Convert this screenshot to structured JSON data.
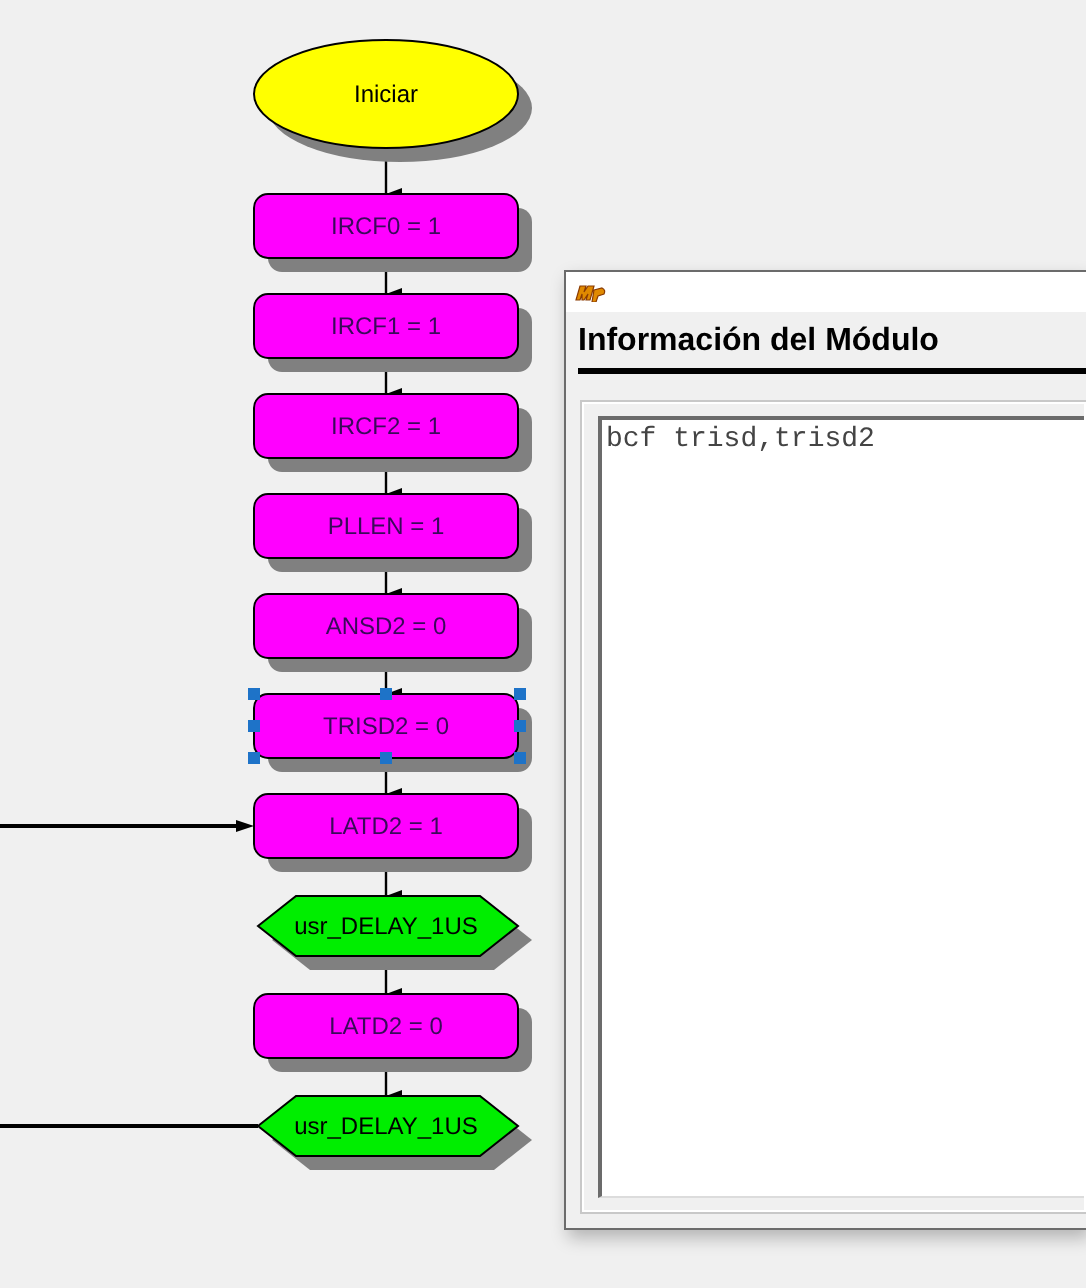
{
  "flowchart": {
    "nodes": [
      {
        "kind": "start",
        "label": "Iniciar",
        "selected": false,
        "left_link": false
      },
      {
        "kind": "process",
        "label": "IRCF0 = 1",
        "selected": false,
        "left_link": false
      },
      {
        "kind": "process",
        "label": "IRCF1 = 1",
        "selected": false,
        "left_link": false
      },
      {
        "kind": "process",
        "label": "IRCF2 = 1",
        "selected": false,
        "left_link": false
      },
      {
        "kind": "process",
        "label": "PLLEN = 1",
        "selected": false,
        "left_link": false
      },
      {
        "kind": "process",
        "label": "ANSD2 = 0",
        "selected": false,
        "left_link": false
      },
      {
        "kind": "process",
        "label": "TRISD2 = 0",
        "selected": true,
        "left_link": false
      },
      {
        "kind": "process",
        "label": "LATD2 = 1",
        "selected": false,
        "left_link": true,
        "left_arrowhead": true
      },
      {
        "kind": "subroutine",
        "label": "usr_DELAY_1US",
        "selected": false,
        "left_link": false
      },
      {
        "kind": "process",
        "label": "LATD2 = 0",
        "selected": false,
        "left_link": false
      },
      {
        "kind": "subroutine",
        "label": "usr_DELAY_1US",
        "selected": false,
        "left_link": true,
        "left_arrowhead": false
      }
    ]
  },
  "module_panel": {
    "title": "Información del Módulo",
    "code": "bcf trisd,trisd2"
  }
}
